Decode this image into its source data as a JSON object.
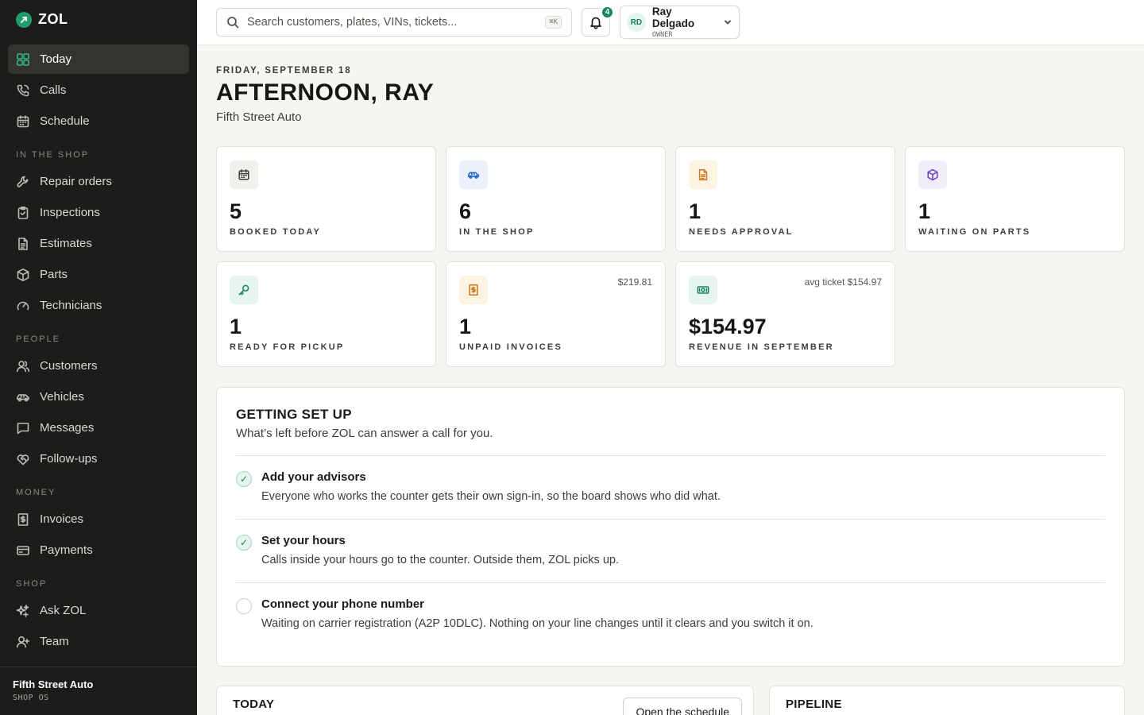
{
  "brand": {
    "name": "ZOL",
    "icon": "zol-logo-icon"
  },
  "sidebar": {
    "items": [
      {
        "label": "Today",
        "icon": "grid-icon",
        "active": true
      },
      {
        "label": "Calls",
        "icon": "phone-icon"
      },
      {
        "label": "Schedule",
        "icon": "calendar-icon"
      }
    ],
    "sections": [
      {
        "title": "IN THE SHOP",
        "items": [
          {
            "label": "Repair orders",
            "icon": "wrench-icon"
          },
          {
            "label": "Inspections",
            "icon": "clipboard-icon"
          },
          {
            "label": "Estimates",
            "icon": "document-icon"
          },
          {
            "label": "Parts",
            "icon": "box-icon"
          },
          {
            "label": "Technicians",
            "icon": "gauge-icon"
          }
        ]
      },
      {
        "title": "PEOPLE",
        "items": [
          {
            "label": "Customers",
            "icon": "users-icon"
          },
          {
            "label": "Vehicles",
            "icon": "car-icon"
          },
          {
            "label": "Messages",
            "icon": "message-icon"
          },
          {
            "label": "Follow-ups",
            "icon": "heart-handshake-icon"
          }
        ]
      },
      {
        "title": "MONEY",
        "items": [
          {
            "label": "Invoices",
            "icon": "receipt-icon"
          },
          {
            "label": "Payments",
            "icon": "card-icon"
          }
        ]
      },
      {
        "title": "SHOP",
        "items": [
          {
            "label": "Ask ZOL",
            "icon": "sparkles-icon"
          },
          {
            "label": "Team",
            "icon": "user-plus-icon"
          }
        ]
      }
    ],
    "footer": {
      "shop_name": "Fifth Street Auto",
      "sub": "SHOP OS"
    }
  },
  "header": {
    "search_placeholder": "Search customers, plates, VINs, tickets...",
    "search_shortcut": "⌘K",
    "notification_count": "4",
    "user": {
      "initials": "RD",
      "name": "Ray Delgado",
      "role": "OWNER"
    }
  },
  "main": {
    "date": "FRIDAY, SEPTEMBER 18",
    "greeting": "AFTERNOON, RAY",
    "shop": "Fifth Street Auto",
    "stats": [
      {
        "value": "5",
        "label": "BOOKED TODAY",
        "icon": "calendar-icon",
        "aside": "",
        "bg": "#f1f0ec",
        "color": "#3d3c38"
      },
      {
        "value": "6",
        "label": "IN THE SHOP",
        "icon": "car-icon",
        "aside": "",
        "bg": "#eaf1fb",
        "color": "#2563c9"
      },
      {
        "value": "1",
        "label": "NEEDS APPROVAL",
        "icon": "document-icon",
        "aside": "",
        "bg": "#fdf3e2",
        "color": "#c9791a"
      },
      {
        "value": "1",
        "label": "WAITING ON PARTS",
        "icon": "box-icon",
        "aside": "",
        "bg": "#f2edfb",
        "color": "#6d3fd0"
      },
      {
        "value": "1",
        "label": "READY FOR PICKUP",
        "icon": "key-icon",
        "aside": "",
        "bg": "#e6f6ee",
        "color": "#16855a"
      },
      {
        "value": "1",
        "label": "UNPAID INVOICES",
        "icon": "receipt-icon",
        "aside": "$219.81",
        "bg": "#fdf3e2",
        "color": "#c9791a"
      },
      {
        "value": "$154.97",
        "label": "REVENUE IN SEPTEMBER",
        "icon": "cash-icon",
        "aside": "avg ticket $154.97",
        "bg": "#e6f6ee",
        "color": "#16855a"
      }
    ],
    "setup": {
      "title": "GETTING SET UP",
      "subtitle": "What’s left before ZOL can answer a call for you.",
      "tasks": [
        {
          "title": "Add your advisors",
          "desc": "Everyone who works the counter gets their own sign-in, so the board shows who did what.",
          "done": true
        },
        {
          "title": "Set your hours",
          "desc": "Calls inside your hours go to the counter. Outside them, ZOL picks up.",
          "done": true
        },
        {
          "title": "Connect your phone number",
          "desc": "Waiting on carrier registration (A2P 10DLC). Nothing on your line changes until it clears and you switch it on.",
          "done": false
        }
      ]
    },
    "today_panel": {
      "title": "TODAY",
      "button": "Open the schedule"
    },
    "pipeline_panel": {
      "title": "PIPELINE"
    }
  }
}
